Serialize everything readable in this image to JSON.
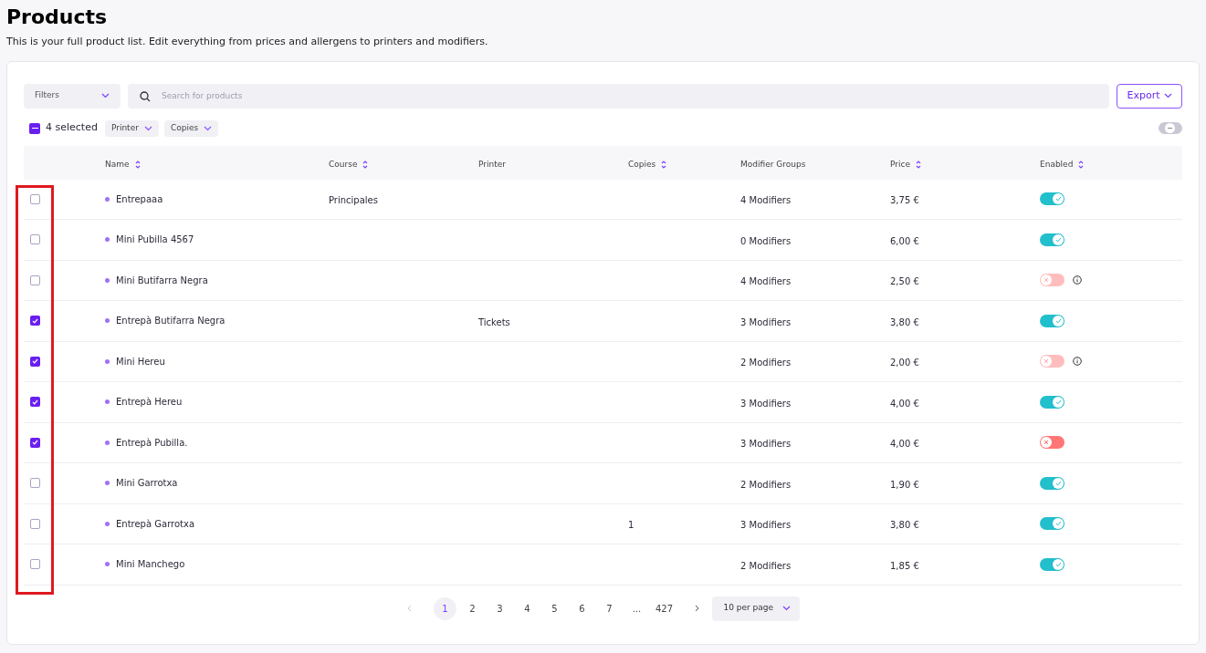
{
  "page": {
    "title": "Products",
    "subtitle": "This is your full product list. Edit everything from prices and allergens to printers and modifiers."
  },
  "toolbar": {
    "filters": "Filters",
    "search": {
      "placeholder": "Search for products"
    },
    "export": "Export"
  },
  "selection": {
    "count": "4 selected",
    "checked": true,
    "actions": [
      "Printer",
      "Copies"
    ],
    "bulk_toggle_on": false
  },
  "checkbox_column_highlighted": true,
  "table": {
    "columns": [
      {
        "label": "Name",
        "sortable": true
      },
      {
        "label": "Course",
        "sortable": true
      },
      {
        "label": "Printer",
        "sortable": false
      },
      {
        "label": "Copies",
        "sortable": true
      },
      {
        "label": "Modifier Groups",
        "sortable": false
      },
      {
        "label": "Price",
        "sortable": true
      },
      {
        "label": "Enabled",
        "sortable": true
      }
    ],
    "rows": [
      {
        "checked": false,
        "name": "Entrepaaa",
        "course": "Principales",
        "modifiers": "4 Modifiers",
        "price": "3,75 €",
        "enabled": true,
        "locked": false
      },
      {
        "checked": false,
        "name": "Mini Pubilla 4567",
        "modifiers": "0 Modifiers",
        "price": "6,00 €",
        "enabled": true,
        "locked": false
      },
      {
        "checked": false,
        "name": "Mini Butifarra Negra",
        "modifiers": "4 Modifiers",
        "price": "2,50 €",
        "enabled": false,
        "locked": true
      },
      {
        "checked": true,
        "name": "Entrepà Butifarra Negra",
        "printer": "Tickets",
        "modifiers": "3 Modifiers",
        "price": "3,80 €",
        "enabled": true,
        "locked": false
      },
      {
        "checked": true,
        "name": "Mini Hereu",
        "modifiers": "2 Modifiers",
        "price": "2,00 €",
        "enabled": false,
        "locked": true
      },
      {
        "checked": true,
        "name": "Entrepà Hereu",
        "modifiers": "3 Modifiers",
        "price": "4,00 €",
        "enabled": true,
        "locked": false
      },
      {
        "checked": true,
        "name": "Entrepà Pubilla.",
        "modifiers": "3 Modifiers",
        "price": "4,00 €",
        "enabled": false,
        "locked": false
      },
      {
        "checked": false,
        "name": "Mini Garrotxa",
        "modifiers": "2 Modifiers",
        "price": "1,90 €",
        "enabled": true,
        "locked": false
      },
      {
        "checked": false,
        "name": "Entrepà Garrotxa",
        "copies": "1",
        "modifiers": "3 Modifiers",
        "price": "3,80 €",
        "enabled": true,
        "locked": false
      },
      {
        "checked": false,
        "name": "Mini Manchego",
        "modifiers": "2 Modifiers",
        "price": "1,85 €",
        "enabled": true,
        "locked": false
      }
    ]
  },
  "pagination": {
    "pages": [
      {
        "label": "1",
        "selected": true
      },
      {
        "label": "2",
        "selected": false
      },
      {
        "label": "3",
        "selected": false
      },
      {
        "label": "4",
        "selected": false
      },
      {
        "label": "5",
        "selected": false
      },
      {
        "label": "6",
        "selected": false
      },
      {
        "label": "7",
        "selected": false
      },
      {
        "label": "...",
        "selected": false
      },
      {
        "label": "427",
        "selected": false
      }
    ],
    "per_page": "10 per page"
  }
}
